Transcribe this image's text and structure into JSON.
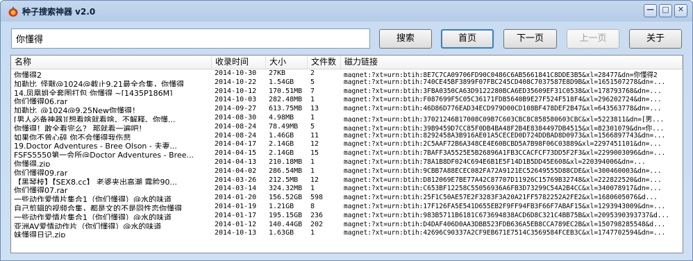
{
  "window": {
    "title": "种子搜索神器 v2.0",
    "controls": {
      "minimize": "—",
      "maximize": "□",
      "close": "✕"
    }
  },
  "search": {
    "value": "你懂得"
  },
  "buttons": {
    "search": "搜索",
    "home": "首页",
    "next": "下一页",
    "prev": "上一页",
    "about": "关于"
  },
  "table": {
    "columns": [
      "名称",
      "收录时间",
      "大小",
      "文件数",
      "磁力链接"
    ],
    "rows": [
      [
        "你懂得2",
        "2014-10-30",
        "27KB",
        "2",
        "magnet:?xt=urn:btih:8E7C7CA09706FD90C0486C6AB5661841C8DDE3B5&xl=28477&dn=你懂得2"
      ],
      [
        "加勒比_怪獸@1024@截止9.21最全合集，你懂得",
        "2014-10-22",
        "1.54GB",
        "5",
        "magnet:?xt=urn:btih:740CE45BF3899F07FBC245CD408C7037587E8D9B&xl=1651507278&dn=..."
      ],
      [
        "14.凤凰姐全套图打包 你懂得 ~[1435P186M]",
        "2014-10-12",
        "170.51MB",
        "7",
        "magnet:?xt=urn:btih:3FBA0350CA63D9122280BCA6ED35609EF31C0538&xl=178793768&dn=..."
      ],
      [
        "你们懂得06.rar",
        "2014-10-03",
        "282.48MB",
        "1",
        "magnet:?xt=urn:btih:F087699F5C05C36171FDB5640B9E27F524F518F4&xl=296202724&dn=..."
      ],
      [
        "加勒比_@1024@9.25New你懂得！",
        "2014-09-27",
        "613.75MB",
        "13",
        "magnet:?xt=urn:btih:46D86D776EAD34ECD979D00CD108BF478DEF2B47&xl=643563778&dn=..."
      ],
      [
        "[男人必备神器][想看啥就看啥、不解释、你懂...",
        "2014-08-30",
        "4.98MB",
        "1",
        "magnet:?xt=urn:btih:37021246B17008C09B7C603CBC8C858580603CBC&xl=5223811&dn=[男..."
      ],
      [
        "你懂得！敢全看完么？ 那就看一遍吧！",
        "2014-08-24",
        "78.49MB",
        "5",
        "magnet:?xt=urn:btih:39B9459D7CC85F0DB4BA48F2B4E8384497DB4515&xl=82301079&dn=你..."
      ],
      [
        "如果你不曾心碎 你不会懂得我伤悲",
        "2014-08-24",
        "1.46GB",
        "11",
        "magnet:?xt=urn:btih:8292458A3B916AE01A5CECED0D724DDBAD8D0973&xl=1566897743&dn=..."
      ],
      [
        "19.Doctor Adventures - Bree Olson - 夫妻...",
        "2014-04-17",
        "2.14GB",
        "12",
        "magnet:?xt=urn:btih:2C5AAF72B6A348CE4E60BCBD5A7B98F06C03889&xl=2297451101&dn=..."
      ],
      [
        "FSFS5550第一会所@Doctor Adventures - Bree...",
        "2014-04-15",
        "2.14GB",
        "15",
        "magnet:?xt=urn:btih:7BAFF3A5525E5B26896A1FB3CCACFCF73DD5F2F3&xl=2299003096&dn=..."
      ],
      [
        "你懂得.zip",
        "2014-04-13",
        "210.18MB",
        "1",
        "magnet:?xt=urn:btih:78A1B8DF024C694E6B1E5F14D1B5DD45E608&xl=220394006&dn=..."
      ],
      [
        "你们懂得09.rar",
        "2014-04-02",
        "286.54MB",
        "1",
        "magnet:?xt=urn:btih:9CBB7A88ECEC082FA72A9121EC52649555D88CDE&xl=300460003&dn=..."
      ],
      [
        "【黑琴枝】【SEX8.cc】 老婆夹出高潮 露脸90...",
        "2014-03-26",
        "212.5MB",
        "12",
        "magnet:?xt=urn:btih:D812069E7BE77A42C87707D11926C15769B32748&xl=222822520&dn=..."
      ],
      [
        "你们懂得07.rar",
        "2014-03-14",
        "324.32MB",
        "1",
        "magnet:?xt=urn:btih:C653BF12258C55056936A6FB3D73299C54A2B4CC&xl=340078917&dn=..."
      ],
      [
        "一些动作爱情片集合1（你们懂得）@水的味道",
        "2014-01-20",
        "156.52GB",
        "598",
        "magnet:?xt=urn:btih:25F1C50AE57E2F3283F3A20A21FF5782252A2FE2&xl=1680605076&d..."
      ],
      [
        "自己剪辑的视频合集，都是文的不是同性恋你懂得",
        "2014-01-19",
        "1.21GB",
        "8",
        "magnet:?xt=urn:btih:17F126FA5E541D655EB2F9FF94FB3F66F7ABAF15&xl=1293943009&dn=..."
      ],
      [
        "一些动作爱情片集合1（你们懂得）@水的味道",
        "2014-01-17",
        "195.15GB",
        "236",
        "magnet:?xt=urn:btih:983B5711B6181C673694838ACD6D8C321C4BB75B&xl=2095390393737&d..."
      ],
      [
        "亚洲AV爱情动作片（你们懂得）@水的味道",
        "2014-01-12",
        "140.44GB",
        "202",
        "magnet:?xt=urn:btih:D4DAF406D0AA3DBB523FDB636A5EB8CCA789EC2B&xl=150798285548&d..."
      ],
      [
        "妹懂得日记.zip",
        "2014-10-13",
        "1.63GB",
        "1",
        "magnet:?xt=urn:btih:42696C90337A2CF9EB671E7514C3569584FCEB3C&xl=1747702594&dn=..."
      ]
    ]
  }
}
